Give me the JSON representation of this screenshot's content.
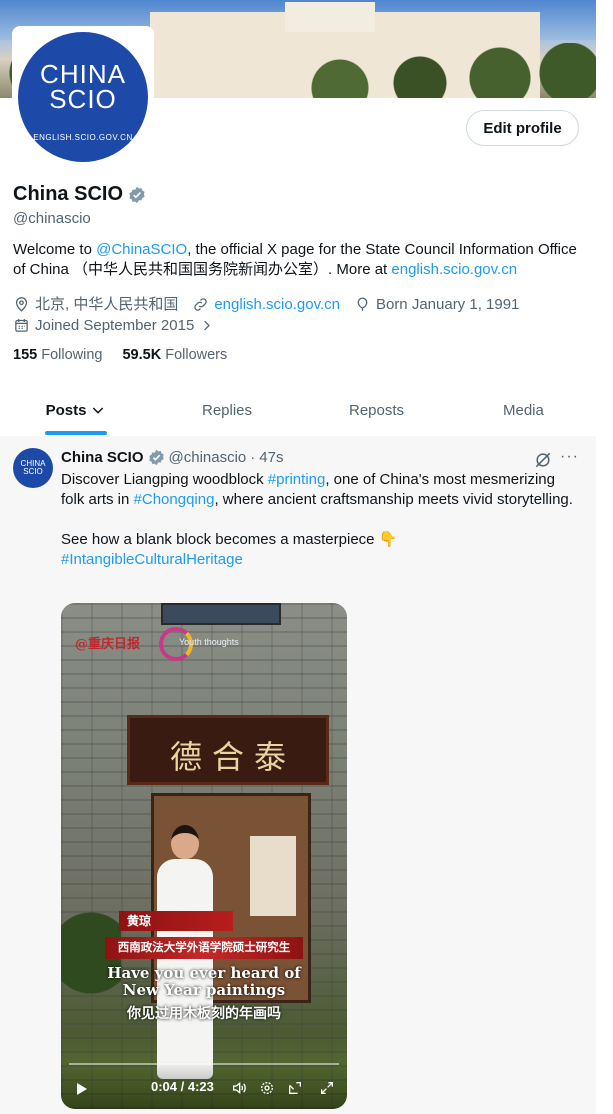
{
  "profile": {
    "avatar_text_line1": "CHINA",
    "avatar_text_line2": "SCIO",
    "avatar_text_line3": "ENGLISH.SCIO.GOV.CN",
    "edit_profile_label": "Edit profile",
    "name": "China SCIO",
    "handle": "@chinascio",
    "bio": {
      "part1": "Welcome to ",
      "mention": "@ChinaSCIO",
      "part2": ", the official X page for the State Council Information Office of China （中华人民共和国国务院新闻办公室）. More at ",
      "link": "english.scio.gov.cn"
    },
    "location": "北京, 中华人民共和国",
    "website": "english.scio.gov.cn",
    "born": "Born January 1, 1991",
    "joined": "Joined September 2015",
    "following_count": "155",
    "following_label": "Following",
    "followers_count": "59.5K",
    "followers_label": "Followers"
  },
  "tabs": [
    {
      "label": "Posts",
      "active": true
    },
    {
      "label": "Replies",
      "active": false
    },
    {
      "label": "Reposts",
      "active": false
    },
    {
      "label": "Media",
      "active": false
    }
  ],
  "post": {
    "avatar_line1": "CHINA",
    "avatar_line2": "SCIO",
    "name": "China SCIO",
    "handle": "@chinascio",
    "separator": "·",
    "time": "47s",
    "more": "···",
    "text": {
      "t1": "Discover Liangping woodblock ",
      "h1": "#printing",
      "t2": ", one of China's most mesmerizing folk arts in ",
      "h2": "#Chongqing",
      "t3": ", where ancient craftsmanship meets vivid storytelling.",
      "t4": "See how a blank block becomes a masterpiece 👇",
      "h3": "#IntangibleCulturalHeritage"
    },
    "video": {
      "logo1": "@重庆日报",
      "logo2": "Youth thoughts",
      "board": "德合泰",
      "caption_name": "黄琼",
      "caption_title": "西南政法大学外语学院硕士研究生",
      "subtitle_en": "Have you ever heard of New Year paintings",
      "subtitle_zh": "你见过用木板刻的年画吗",
      "time": "0:04 / 4:23"
    }
  },
  "colors": {
    "link": "#1d9bf0",
    "muted": "#536471",
    "brand": "#1d4aa8"
  }
}
